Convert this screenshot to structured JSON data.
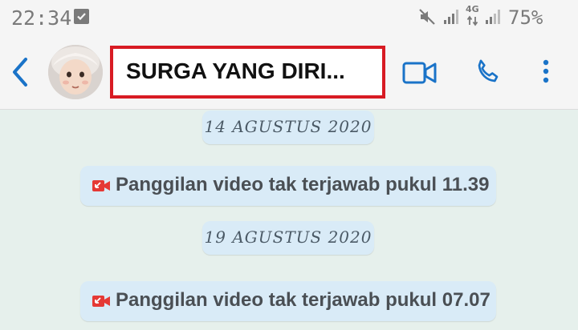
{
  "status_bar": {
    "time": "22:34",
    "network": "4G",
    "battery": "75%"
  },
  "header": {
    "contact_name": "SURGA YANG DIRI...",
    "icons": {
      "back": "chevron-left-icon",
      "video": "video-camera-icon",
      "phone": "phone-icon",
      "more": "more-vert-icon"
    }
  },
  "chat": {
    "items": [
      {
        "type": "date",
        "text": "14 AGUSTUS 2020"
      },
      {
        "type": "missed_video_call",
        "text": "Panggilan video tak terjawab pukul 11.39"
      },
      {
        "type": "date",
        "text": "19 AGUSTUS 2020"
      },
      {
        "type": "missed_video_call",
        "text": "Panggilan video tak terjawab pukul 07.07"
      }
    ]
  },
  "colors": {
    "accent": "#1a73c8",
    "highlight_border": "#d81b23",
    "missed_call": "#e53935",
    "chat_background": "#e6f0ec",
    "system_bubble": "#d9ebf7"
  }
}
